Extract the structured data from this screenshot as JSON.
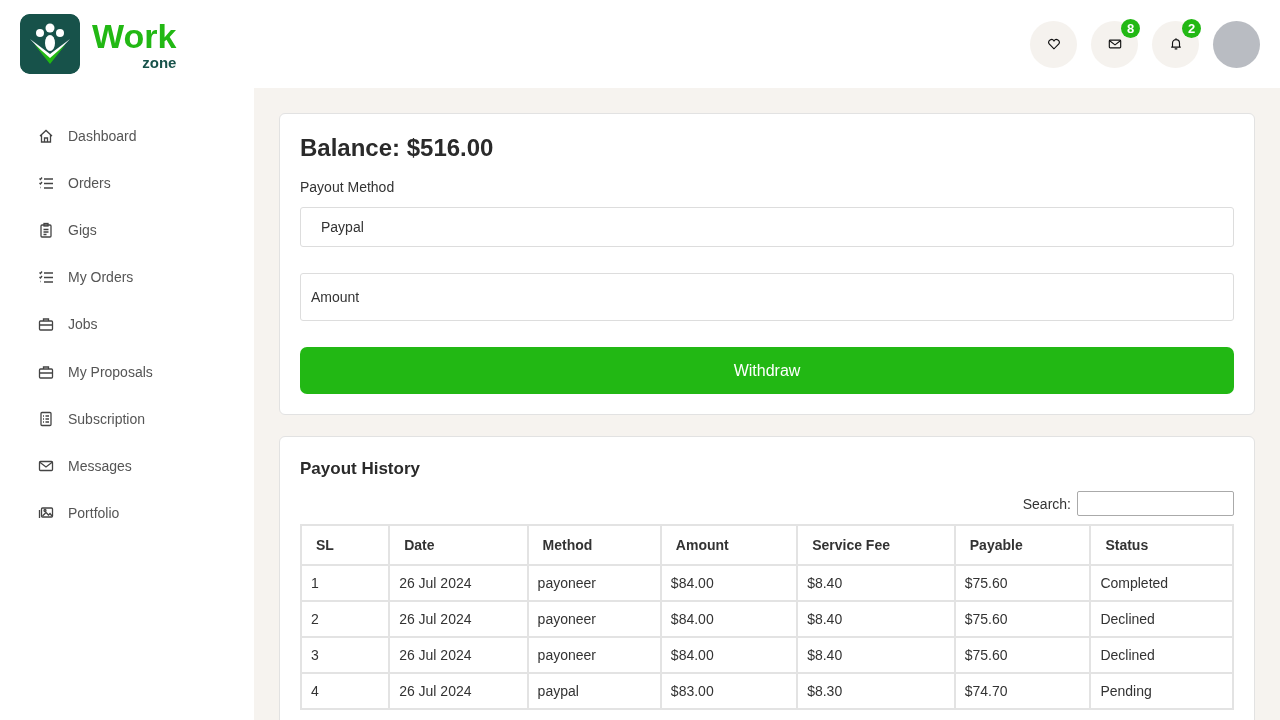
{
  "logo": {
    "title": "Work",
    "subtitle": "zone"
  },
  "header": {
    "messages_badge": "8",
    "notifications_badge": "2"
  },
  "sidebar": {
    "items": [
      {
        "label": "Dashboard"
      },
      {
        "label": "Orders"
      },
      {
        "label": "Gigs"
      },
      {
        "label": "My Orders"
      },
      {
        "label": "Jobs"
      },
      {
        "label": "My Proposals"
      },
      {
        "label": "Subscription"
      },
      {
        "label": "Messages"
      },
      {
        "label": "Portfolio"
      }
    ]
  },
  "balance": {
    "title": "Balance: $516.00",
    "method_label": "Payout Method",
    "method_value": "Paypal",
    "amount_placeholder": "Amount",
    "button": "Withdraw"
  },
  "history": {
    "title": "Payout History",
    "search_label": "Search:",
    "columns": [
      "SL",
      "Date",
      "Method",
      "Amount",
      "Service Fee",
      "Payable",
      "Status"
    ],
    "rows": [
      [
        "1",
        "26 Jul 2024",
        "payoneer",
        "$84.00",
        "$8.40",
        "$75.60",
        "Completed"
      ],
      [
        "2",
        "26 Jul 2024",
        "payoneer",
        "$84.00",
        "$8.40",
        "$75.60",
        "Declined"
      ],
      [
        "3",
        "26 Jul 2024",
        "payoneer",
        "$84.00",
        "$8.40",
        "$75.60",
        "Declined"
      ],
      [
        "4",
        "26 Jul 2024",
        "paypal",
        "$83.00",
        "$8.30",
        "$74.70",
        "Pending"
      ]
    ]
  }
}
